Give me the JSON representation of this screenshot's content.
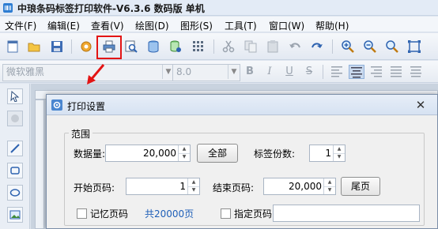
{
  "window": {
    "title": "中琅条码标签打印软件-V6.3.6 数码版 单机"
  },
  "menu": [
    {
      "label": "文件(F)"
    },
    {
      "label": "编辑(E)"
    },
    {
      "label": "查看(V)"
    },
    {
      "label": "绘图(D)"
    },
    {
      "label": "图形(S)"
    },
    {
      "label": "工具(T)"
    },
    {
      "label": "窗口(W)"
    },
    {
      "label": "帮助(H)"
    }
  ],
  "toolbar": {
    "icons": [
      "new-file-icon",
      "open-folder-icon",
      "save-icon",
      "settings-gear-icon",
      "print-icon",
      "print-preview-icon",
      "database-icon",
      "database-settings-icon",
      "grid-icon",
      "cut-icon",
      "copy-icon",
      "paste-icon",
      "undo-icon",
      "redo-icon",
      "zoom-in-icon",
      "zoom-out-icon",
      "zoom-actual-icon",
      "fit-page-icon"
    ],
    "highlight_color": "#e31414"
  },
  "format": {
    "font": "微软雅黑",
    "size": "8.0",
    "bold": "B",
    "italic": "I",
    "underline": "U",
    "strike": "S"
  },
  "dialog": {
    "title": "打印设置",
    "close": "✕",
    "group_label": "范围",
    "data_qty_label": "数据量:",
    "data_qty_value": "20,000",
    "all_button": "全部",
    "copies_label": "标签份数:",
    "copies_value": "1",
    "start_page_label": "开始页码:",
    "start_page_value": "1",
    "end_page_label": "结束页码:",
    "end_page_value": "20,000",
    "last_page_button": "尾页",
    "remember_label": "记忆页码",
    "total_pages": "共20000页",
    "specify_label": "指定页码",
    "specify_value": ""
  },
  "colors": {
    "accent_blue": "#1f5fb8",
    "arrow_red": "#e31414"
  }
}
